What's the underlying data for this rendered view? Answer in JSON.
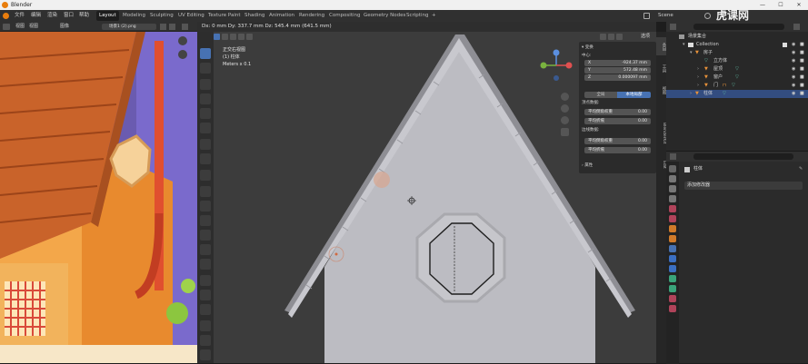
{
  "titlebar": {
    "title": "Blender"
  },
  "menus": [
    "文件",
    "编辑",
    "渲染",
    "窗口",
    "帮助"
  ],
  "workspaces": [
    "Layout",
    "Modeling",
    "Sculpting",
    "UV Editing",
    "Texture Paint",
    "Shading",
    "Animation",
    "Rendering",
    "Compositing",
    "Geometry Nodes",
    "Scripting",
    "+"
  ],
  "scene": {
    "label": "Scene"
  },
  "image_editor": {
    "menus": [
      "视图",
      "视图",
      "图像"
    ],
    "image_name": "场景1 (2).png"
  },
  "viewport": {
    "measure": "Dx: 0 mm   Dy: 337.7 mm   Dz: 545.4 mm (641.5 mm)",
    "view_name": "正交右视图",
    "object_label": "(1) 柱体",
    "scale_label": "Meters x 0.1",
    "options_label": "选项"
  },
  "npanel": {
    "transform_header": "变换",
    "median_label": "中心:",
    "x": {
      "label": "X",
      "value": "-924.37 mm"
    },
    "y": {
      "label": "Y",
      "value": "572.48 mm"
    },
    "z": {
      "label": "Z",
      "value": "0.000097 mm"
    },
    "global_btn": "全局",
    "local_btn": "本地局部",
    "vertex_data": "顶点数据:",
    "vweight1": {
      "label": "平均倒角权重",
      "value": "0.00"
    },
    "vweight2": {
      "label": "平均折痕",
      "value": "0.00"
    },
    "edge_data": "边线数据:",
    "eweight1": {
      "label": "平均倒角权重",
      "value": "0.00"
    },
    "eweight2": {
      "label": "平均折痕",
      "value": "0.00"
    },
    "props_header": "属性"
  },
  "sidetabs": [
    "条目",
    "工具",
    "视图",
    "BlenderKit",
    "Edit"
  ],
  "outliner": {
    "rows": [
      {
        "label": "场景集合"
      },
      {
        "label": "Collection"
      },
      {
        "label": "房子"
      },
      {
        "label": "立方体"
      },
      {
        "label": "屋顶"
      },
      {
        "label": "窗户"
      },
      {
        "label": "门"
      },
      {
        "label": "柱体"
      }
    ]
  },
  "properties": {
    "object_name": "柱体",
    "add_modifier": "添加修改器"
  },
  "watermark": "虎课网",
  "colors": {
    "accent": "#4772b3",
    "selection": "#334d80",
    "orange": "#e87d0d"
  }
}
